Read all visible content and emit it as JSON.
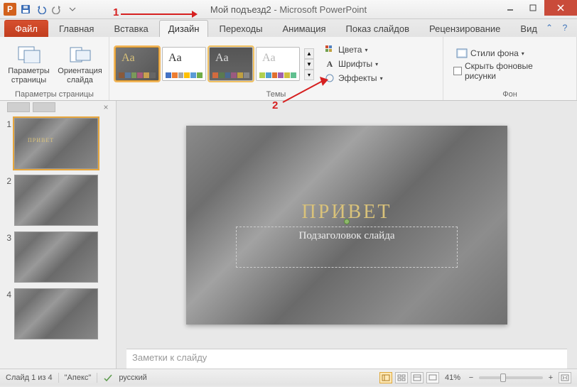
{
  "title": {
    "doc": "Мой подъезд2",
    "app": "Microsoft PowerPoint"
  },
  "qat": {
    "app_letter": "P"
  },
  "tabs": {
    "file": "Файл",
    "items": [
      "Главная",
      "Вставка",
      "Дизайн",
      "Переходы",
      "Анимация",
      "Показ слайдов",
      "Рецензирование",
      "Вид"
    ],
    "active_index": 2
  },
  "ribbon": {
    "page_setup": {
      "label": "Параметры страницы",
      "btn_page": "Параметры страницы",
      "btn_orient": "Ориентация слайда"
    },
    "themes": {
      "label": "Темы",
      "colors": "Цвета",
      "fonts": "Шрифты",
      "effects": "Эффекты"
    },
    "background": {
      "label": "Фон",
      "styles": "Стили фона",
      "hide": "Скрыть фоновые рисунки"
    }
  },
  "thumbs": {
    "count": 4,
    "selected": 1,
    "title_text": "ПРИВЕТ"
  },
  "slide": {
    "title": "ПРИВЕТ",
    "subtitle": "Подзаголовок слайда"
  },
  "notes_placeholder": "Заметки к слайду",
  "status": {
    "slide_counter": "Слайд 1 из 4",
    "theme": "\"Апекс\"",
    "lang": "русский",
    "zoom": "41%"
  },
  "anno": {
    "one": "1",
    "two": "2"
  }
}
